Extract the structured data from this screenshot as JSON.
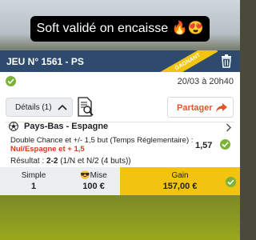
{
  "caption": "Soft validé on encaisse 🔥😍",
  "ticket": {
    "header_title": "JEU N° 1561 - PS",
    "status_ribbon": "GAGNANT",
    "date": "20/03 à 20h40",
    "details_label": "Détails (1)",
    "share_label": "Partager",
    "match": "Pays-Bas - Espagne",
    "bet_type": "Double Chance et +/- 1,5 but (Temps Réglementaire) :",
    "selection": "Nul/Espagne et + 1,5",
    "odds": "1,57",
    "result_label": "Résultat :",
    "result_score": "2-2",
    "result_detail": "(1/N et N/2 (4 buts))",
    "summary": {
      "type_label": "Simple",
      "type_value": "1",
      "stake_label": "😎Mise",
      "stake_value": "100 €",
      "gain_label": "Gain",
      "gain_value": "157,00 €"
    }
  },
  "colors": {
    "header_bg": "#2e4a6d",
    "ribbon": "#f1c40f",
    "win_green": "#7cb23a",
    "accent_orange": "#e2562a",
    "selection_red": "#d63b1f",
    "gain_bg": "#f1c40f"
  },
  "icons": [
    "trash-icon",
    "check-circle-icon",
    "chevron-up-icon",
    "document-search-icon",
    "share-arrow-icon",
    "soccer-ball-icon",
    "chevron-right-icon"
  ]
}
